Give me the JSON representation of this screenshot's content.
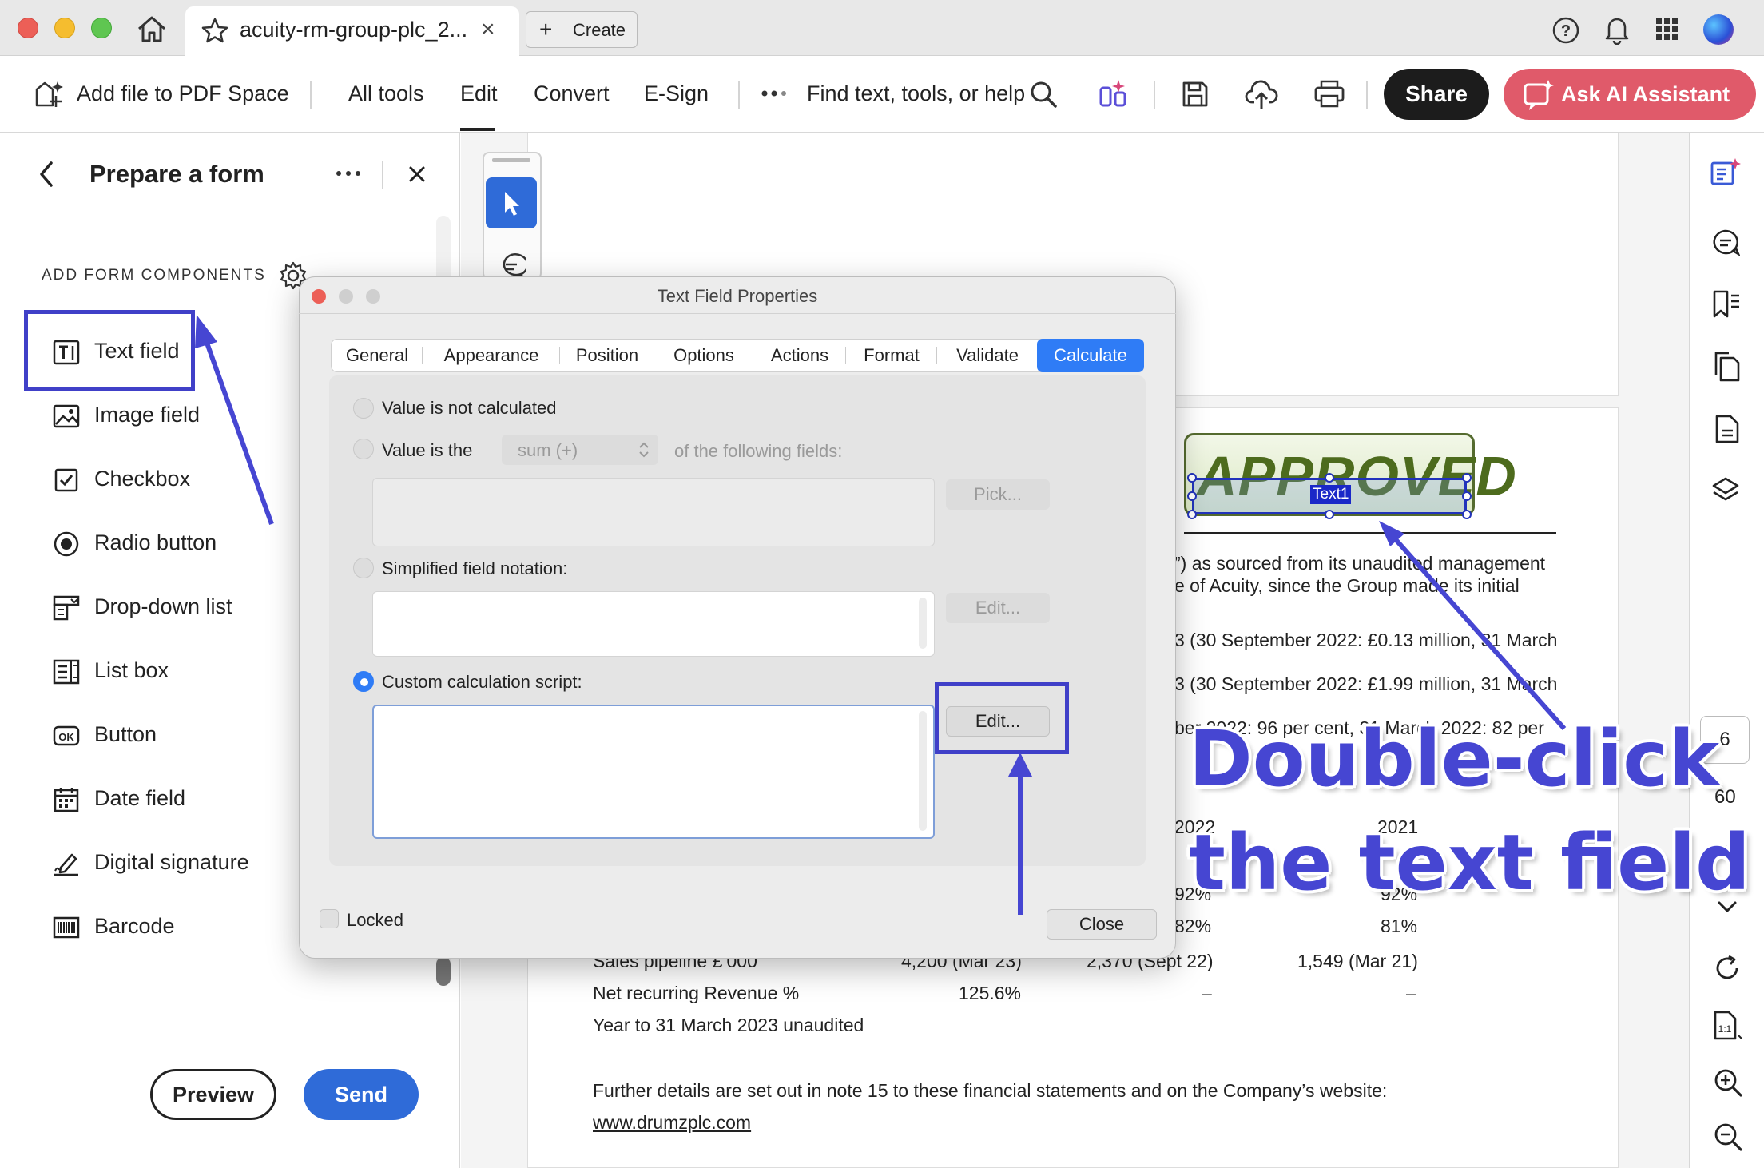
{
  "browser": {
    "tab_title": "acuity-rm-group-plc_2...",
    "create_label": "Create"
  },
  "toolbar": {
    "add_file_label": "Add file to PDF Space",
    "menu": [
      "All tools",
      "Edit",
      "Convert",
      "E-Sign"
    ],
    "search_label": "Find text, tools, or help",
    "share_label": "Share",
    "ai_label": "Ask AI Assistant"
  },
  "left_panel": {
    "title": "Prepare a form",
    "section_heading": "ADD FORM COMPONENTS",
    "components": [
      {
        "label": "Text field",
        "icon": "text-field-icon"
      },
      {
        "label": "Image field",
        "icon": "image-field-icon"
      },
      {
        "label": "Checkbox",
        "icon": "checkbox-icon"
      },
      {
        "label": "Radio button",
        "icon": "radio-button-icon"
      },
      {
        "label": "Drop-down list",
        "icon": "dropdown-list-icon"
      },
      {
        "label": "List box",
        "icon": "list-box-icon"
      },
      {
        "label": "Button",
        "icon": "button-ok-icon"
      },
      {
        "label": "Date field",
        "icon": "date-field-icon"
      },
      {
        "label": "Digital signature",
        "icon": "digital-signature-icon"
      },
      {
        "label": "Barcode",
        "icon": "barcode-icon"
      }
    ],
    "preview_label": "Preview",
    "send_label": "Send"
  },
  "dialog": {
    "title": "Text Field Properties",
    "tabs": [
      "General",
      "Appearance",
      "Position",
      "Options",
      "Actions",
      "Format",
      "Validate",
      "Calculate"
    ],
    "active_tab": "Calculate",
    "opt_not_calculated": "Value is not calculated",
    "opt_value_is_the": "Value is the",
    "operation_select": "sum (+)",
    "following_fields": "of the following fields:",
    "pick_label": "Pick...",
    "opt_simplified": "Simplified field notation:",
    "edit_label_1": "Edit...",
    "opt_custom": "Custom calculation script:",
    "edit_label_2": "Edit...",
    "locked_label": "Locked",
    "close_label": "Close",
    "selected_option": "Custom calculation script:"
  },
  "document": {
    "stamp": "APPROVED",
    "field_name": "Text1",
    "lines": [
      "”) as sourced from its unaudited management",
      "e of Acuity, since the Group made its initial",
      "3 (30 September 2022: £0.13 million, 31 March",
      "3 (30 September 2022: £1.99 million, 31 March",
      "ber 2022: 96 per cent, 31 March 2022: 82 per"
    ],
    "col_2022": "2022",
    "col_2021": "2021",
    "pct_a1": "92%",
    "pct_a2": "92%",
    "pct_b1": "82%",
    "pct_b2": "81%",
    "pipeline_label": "Sales pipeline £’000",
    "pipeline_v1": "4,200 (Mar 23)",
    "pipeline_v2": "2,370 (Sept 22)",
    "pipeline_v3": "1,549 (Mar 21)",
    "nrr_label": "Net recurring Revenue %",
    "nrr_value": "125.6%",
    "dash1": "–",
    "dash2": "–",
    "year_note": "Year to 31 March 2023 unaudited",
    "further": "Further details are set out in note 15 to these financial statements and on the Company’s website:",
    "link": "www.drumzplc.com"
  },
  "page_nav": {
    "current": "6",
    "total": "60"
  },
  "annotation": {
    "line1": "Double-click",
    "line2": "the text field",
    "color": "#4646d2"
  }
}
